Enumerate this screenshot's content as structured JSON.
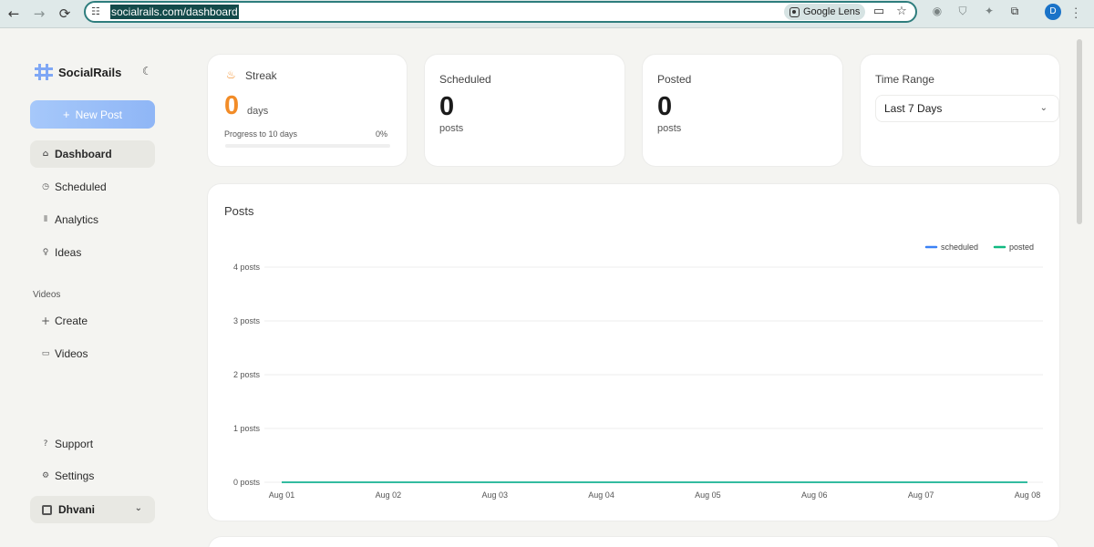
{
  "browser": {
    "url": "socialrails.com/dashboard",
    "lens_label": "Google Lens",
    "profile_initial": "D"
  },
  "sidebar": {
    "brand": "SocialRails",
    "new_post_label": "New Post",
    "items": [
      {
        "label": "Dashboard",
        "icon": "home-icon"
      },
      {
        "label": "Scheduled",
        "icon": "clock-icon"
      },
      {
        "label": "Analytics",
        "icon": "bar-chart-icon"
      },
      {
        "label": "Ideas",
        "icon": "lightbulb-icon"
      }
    ],
    "videos_section_label": "Videos",
    "video_items": [
      {
        "label": "Create",
        "icon": "plus-icon"
      },
      {
        "label": "Videos",
        "icon": "video-icon"
      }
    ],
    "footer_items": [
      {
        "label": "Support",
        "icon": "help-icon"
      },
      {
        "label": "Settings",
        "icon": "gear-icon"
      }
    ],
    "user_name": "Dhvani"
  },
  "stats": {
    "streak": {
      "title": "Streak",
      "value": "0",
      "unit": "days",
      "progress_label": "Progress to 10 days",
      "progress_pct_text": "0%",
      "progress_fraction": 0
    },
    "scheduled": {
      "title": "Scheduled",
      "value": "0",
      "unit": "posts"
    },
    "posted": {
      "title": "Posted",
      "value": "0",
      "unit": "posts"
    },
    "time_range": {
      "title": "Time Range",
      "selected": "Last 7 Days"
    }
  },
  "chart_section": {
    "title": "Posts"
  },
  "colors": {
    "scheduled": "#3b82f6",
    "posted": "#10b981",
    "streak_accent": "#f28c28"
  },
  "chart_data": {
    "type": "line",
    "title": "Posts",
    "categories": [
      "Aug 01",
      "Aug 02",
      "Aug 03",
      "Aug 04",
      "Aug 05",
      "Aug 06",
      "Aug 07",
      "Aug 08"
    ],
    "y_tick_labels": [
      "0 posts",
      "1 posts",
      "2 posts",
      "3 posts",
      "4 posts"
    ],
    "ylim": [
      0,
      4
    ],
    "grid": true,
    "legend_position": "top-right",
    "series": [
      {
        "name": "scheduled",
        "values": [
          0,
          0,
          0,
          0,
          0,
          0,
          0,
          0
        ]
      },
      {
        "name": "posted",
        "values": [
          0,
          0,
          0,
          0,
          0,
          0,
          0,
          0
        ]
      }
    ]
  }
}
